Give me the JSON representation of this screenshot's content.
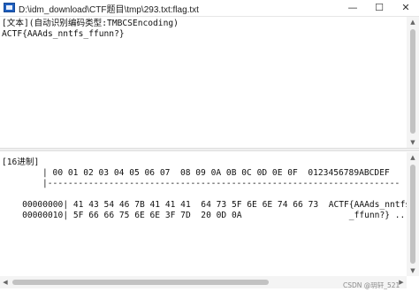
{
  "window": {
    "title": "D:\\idm_download\\CTF题目\\tmp\\293.txt:flag.txt",
    "minimize_glyph": "—",
    "maximize_glyph": "☐",
    "close_glyph": "✕"
  },
  "text_view": {
    "header": "[文本](自动识别编码类型:TMBCSEncoding)",
    "content": "ACTF{AAAds_nntfs_ffunn?}"
  },
  "hex_view": {
    "header": "[16进制]",
    "column_header": "| 00 01 02 03 04 05 06 07  08 09 0A 0B 0C 0D 0E 0F  0123456789ABCDEF",
    "separator": "|---------------------------------------------------------------------",
    "rows": [
      {
        "offset": "00000000",
        "bytes": "41 43 54 46 7B 41 41 41  64 73 5F 6E 6E 74 66 73",
        "ascii": "ACTF{AAAds_nntfs"
      },
      {
        "offset": "00000010",
        "bytes": "5F 66 66 75 6E 6E 3F 7D  20 0D 0A",
        "ascii": "_ffunn?} .."
      }
    ]
  },
  "scrollbars": {
    "up_glyph": "▲",
    "down_glyph": "▼",
    "left_glyph": "◀",
    "right_glyph": "▶"
  },
  "watermark": "CSDN @玥轩_521",
  "icons": {
    "app": "notepad-app-icon"
  }
}
